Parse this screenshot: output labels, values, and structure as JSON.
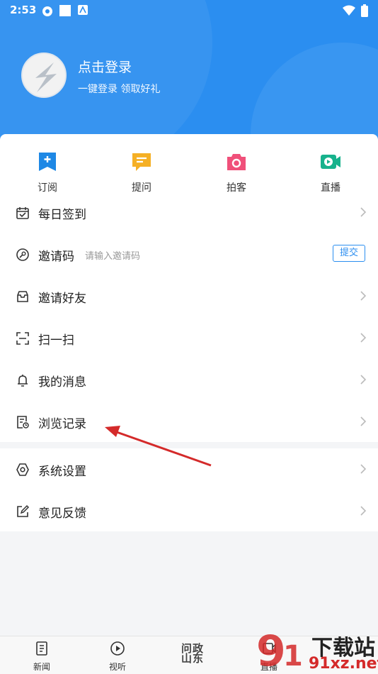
{
  "status": {
    "time": "2:53"
  },
  "profile": {
    "title": "点击登录",
    "subtitle": "一键登录 领取好礼"
  },
  "quick": [
    {
      "label": "订阅",
      "icon": "subscribe-icon",
      "color": "#1e88e5"
    },
    {
      "label": "提问",
      "icon": "question-icon",
      "color": "#f5b025"
    },
    {
      "label": "拍客",
      "icon": "camera-icon",
      "color": "#f0507a"
    },
    {
      "label": "直播",
      "icon": "live-icon",
      "color": "#17b28c"
    }
  ],
  "menu": [
    {
      "label": "每日签到",
      "icon": "calendar-icon"
    },
    {
      "label": "邀请码",
      "icon": "key-icon",
      "placeholder": "请输入邀请码",
      "action": "提交"
    },
    {
      "label": "邀请好友",
      "icon": "mail-icon"
    },
    {
      "label": "扫一扫",
      "icon": "scan-icon"
    },
    {
      "label": "我的消息",
      "icon": "bell-icon"
    },
    {
      "label": "浏览记录",
      "icon": "history-icon"
    },
    {
      "label": "系统设置",
      "icon": "settings-icon"
    },
    {
      "label": "意见反馈",
      "icon": "edit-icon"
    }
  ],
  "tabs": [
    {
      "label": "新闻",
      "icon": "news-icon"
    },
    {
      "label": "视听",
      "icon": "play-icon"
    },
    {
      "label": "问政山东",
      "icon": "brand-logo"
    },
    {
      "label": "直播",
      "icon": "live-tab-icon"
    }
  ],
  "watermark": {
    "text": "下载站",
    "url": "91xz.net"
  },
  "colors": {
    "accent": "#2b8ef0",
    "annotation": "#d42a2a"
  }
}
